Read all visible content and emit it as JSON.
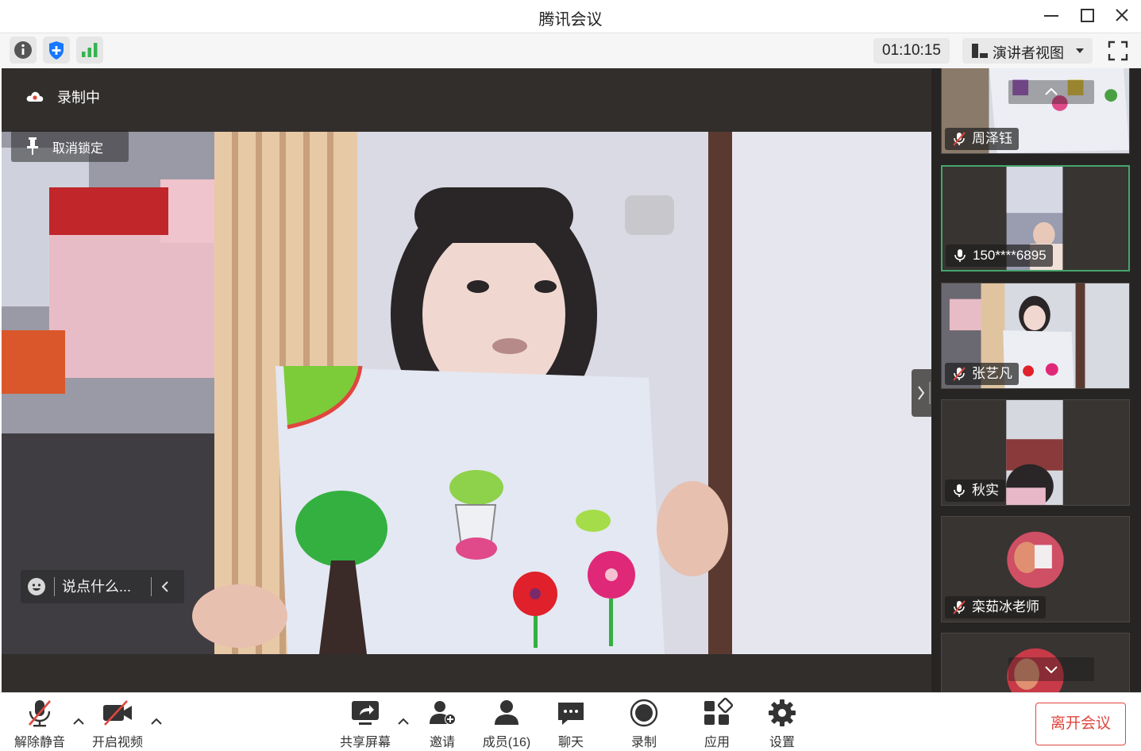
{
  "window": {
    "title": "腾讯会议"
  },
  "toolbar": {
    "timer": "01:10:15",
    "view_mode": "演讲者视图",
    "icons": [
      "info-icon",
      "shield-icon",
      "signal-icon",
      "fullscreen-icon"
    ]
  },
  "stage": {
    "recording_label": "录制中",
    "unlock_label": "取消锁定",
    "chat_placeholder": "说点什么..."
  },
  "participants": [
    {
      "name": "周泽钰",
      "mic": "muted"
    },
    {
      "name": "150****6895",
      "mic": "on",
      "active": true
    },
    {
      "name": "张艺凡",
      "mic": "muted"
    },
    {
      "name": "秋实",
      "mic": "on"
    },
    {
      "name": "栾茹冰老师",
      "mic": "muted"
    }
  ],
  "bottombar": {
    "unmute": "解除静音",
    "video": "开启视频",
    "share": "共享屏幕",
    "invite": "邀请",
    "members": "成员(16)",
    "chat": "聊天",
    "record": "录制",
    "apps": "应用",
    "settings": "设置",
    "leave": "离开会议"
  },
  "colors": {
    "accent_green": "#46a56b",
    "leave_red": "#e0463f",
    "stage_bg": "#312e2c",
    "shield_blue": "#1677ff",
    "signal_green": "#34b450"
  }
}
